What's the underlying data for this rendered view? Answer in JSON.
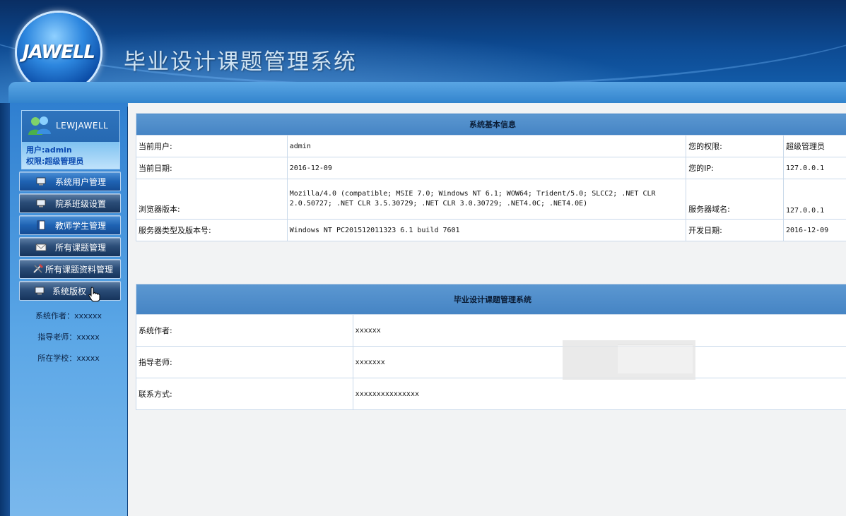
{
  "header": {
    "logo_text": "JAWELL",
    "title": "毕业设计课题管理系统"
  },
  "sidebar": {
    "site_name": "LEWJAWELL",
    "user_line": "用户:admin",
    "role_line": "权限:超级管理员",
    "menu": [
      {
        "label": "系统用户管理",
        "icon": "computer-icon",
        "active": true
      },
      {
        "label": "院系班级设置",
        "icon": "computer-icon",
        "active": false
      },
      {
        "label": "教师学生管理",
        "icon": "book-icon",
        "active": true
      },
      {
        "label": "所有课题管理",
        "icon": "mail-icon",
        "active": false
      },
      {
        "label": "所有课题资料管理",
        "icon": "tools-icon",
        "active": false
      },
      {
        "label": "系统版权",
        "icon": "computer-icon",
        "active": false
      }
    ],
    "info": [
      "系统作者：xxxxxx",
      "指导老师：xxxxx",
      "所在学校：xxxxx"
    ]
  },
  "system_info": {
    "title": "系统基本信息",
    "rows": [
      {
        "l1": "当前用户:",
        "v1": "admin",
        "l2": "您的权限:",
        "v2": "超级管理员"
      },
      {
        "l1": "当前日期:",
        "v1": "2016-12-09",
        "l2": "您的IP:",
        "v2": "127.0.0.1"
      },
      {
        "l1": "浏览器版本:",
        "v1": "Mozilla/4.0 (compatible; MSIE 7.0; Windows NT 6.1; WOW64; Trident/5.0; SLCC2; .NET CLR 2.0.50727; .NET CLR 3.5.30729; .NET CLR 3.0.30729; .NET4.0C; .NET4.0E)",
        "l2": "服务器域名:",
        "v2": "127.0.0.1"
      },
      {
        "l1": "服务器类型及版本号:",
        "v1": "Windows NT PC201512011323 6.1 build 7601",
        "l2": "开发日期:",
        "v2": "2016-12-09"
      }
    ]
  },
  "about": {
    "title": "毕业设计课题管理系统",
    "rows": [
      {
        "label": "系统作者:",
        "value": "xxxxxx"
      },
      {
        "label": "指导老师:",
        "value": "xxxxxxx"
      },
      {
        "label": "联系方式:",
        "value": "xxxxxxxxxxxxxxx"
      }
    ]
  }
}
